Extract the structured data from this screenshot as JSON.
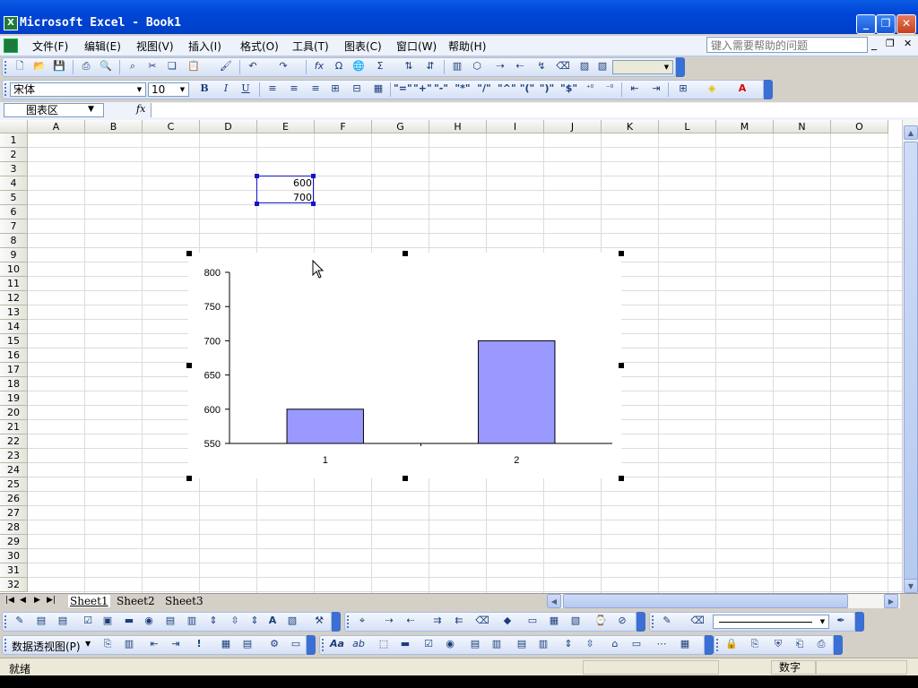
{
  "window": {
    "title": "Microsoft Excel - Book1",
    "app_icon_label": "X",
    "minimize_glyph": "_",
    "restore_glyph": "❐",
    "close_glyph": "✕"
  },
  "menu": {
    "items": [
      "文件(F)",
      "编辑(E)",
      "视图(V)",
      "插入(I)",
      "格式(O)",
      "工具(T)",
      "图表(C)",
      "窗口(W)",
      "帮助(H)"
    ],
    "help_placeholder": "键入需要帮助的问题",
    "doc_min": "_",
    "doc_restore": "❐",
    "doc_close": "✕"
  },
  "format_toolbar": {
    "font": "宋体",
    "size": "10",
    "bold": "B",
    "italic": "I",
    "underline": "U"
  },
  "chart_toolbar_items": [
    "\"=\"",
    "\"+\"",
    "\"-\"",
    "\"*\"",
    "\"/\"",
    "\"^\"",
    "\"(\"",
    "\")\"",
    "\"$\""
  ],
  "formula_bar": {
    "name_box": "图表区",
    "fx": "fx",
    "value": ""
  },
  "grid": {
    "columns": [
      "A",
      "B",
      "C",
      "D",
      "E",
      "F",
      "G",
      "H",
      "I",
      "J",
      "K",
      "L",
      "M",
      "N",
      "O"
    ],
    "rows": [
      "1",
      "2",
      "3",
      "4",
      "5",
      "6",
      "7",
      "8",
      "9",
      "10",
      "11",
      "12",
      "13",
      "14",
      "15",
      "16",
      "17",
      "18",
      "19",
      "20",
      "21",
      "22",
      "23",
      "24",
      "25",
      "26",
      "27",
      "28",
      "29",
      "30",
      "31",
      "32"
    ],
    "cells": [
      {
        "ref": "E4",
        "value": "600"
      },
      {
        "ref": "E5",
        "value": "700"
      }
    ]
  },
  "chart_data": {
    "type": "bar",
    "categories": [
      "1",
      "2"
    ],
    "values": [
      600,
      700
    ],
    "ylim": [
      550,
      800
    ],
    "yticks": [
      550,
      600,
      650,
      700,
      750,
      800
    ],
    "bar_color": "#9999ff",
    "grid": false,
    "legend": "none"
  },
  "sheets": {
    "tabs": [
      "Sheet1",
      "Sheet2",
      "Sheet3"
    ],
    "active": "Sheet1",
    "nav": [
      "|◀",
      "◀",
      "▶",
      "▶|"
    ]
  },
  "pivot_toolbar": {
    "label": "数据透视图(P)"
  },
  "status": {
    "ready": "就绪",
    "mode": "数字"
  },
  "colors": {
    "titlebar": "#0a5be4",
    "selection": "#1515c8",
    "bar_fill": "#9999ff"
  }
}
